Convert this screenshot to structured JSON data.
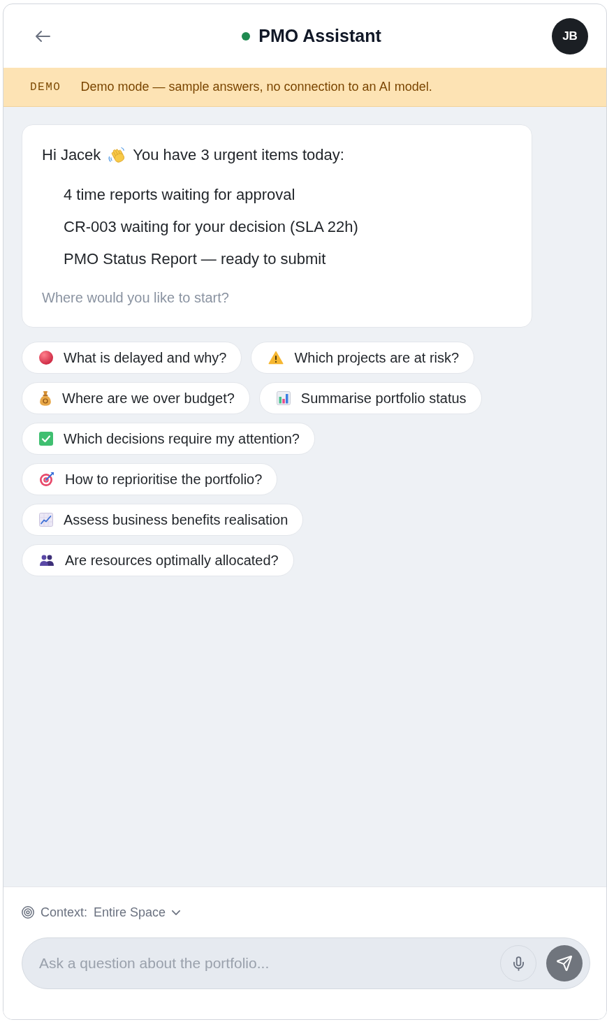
{
  "header": {
    "title": "PMO Assistant",
    "online": true,
    "avatar_initials": "JB"
  },
  "banner": {
    "tag": "DEMO",
    "message": "Demo mode — sample answers, no connection to an AI model."
  },
  "message": {
    "greeting": "Hi Jacek",
    "intro": "You have 3 urgent items today:",
    "items": [
      "4 time reports waiting for approval",
      "CR-003 waiting for your decision (SLA 22h)",
      "PMO Status Report — ready to submit"
    ],
    "prompt": "Where would you like to start?"
  },
  "suggestions": [
    {
      "kind": "delay",
      "label": "What is delayed and why?"
    },
    {
      "kind": "risk",
      "label": "Which projects are at risk?"
    },
    {
      "kind": "budget",
      "label": "Where are we over budget?"
    },
    {
      "kind": "summary",
      "label": "Summarise portfolio status"
    },
    {
      "kind": "decision",
      "label": "Which decisions require my attention?"
    },
    {
      "kind": "priority",
      "label": "How to reprioritise the portfolio?"
    },
    {
      "kind": "benefit",
      "label": "Assess business benefits realisation"
    },
    {
      "kind": "resource",
      "label": "Are resources optimally allocated?"
    }
  ],
  "composer": {
    "context_label": "Context:",
    "context_value": "Entire Space",
    "placeholder": "Ask a question about the portfolio..."
  }
}
